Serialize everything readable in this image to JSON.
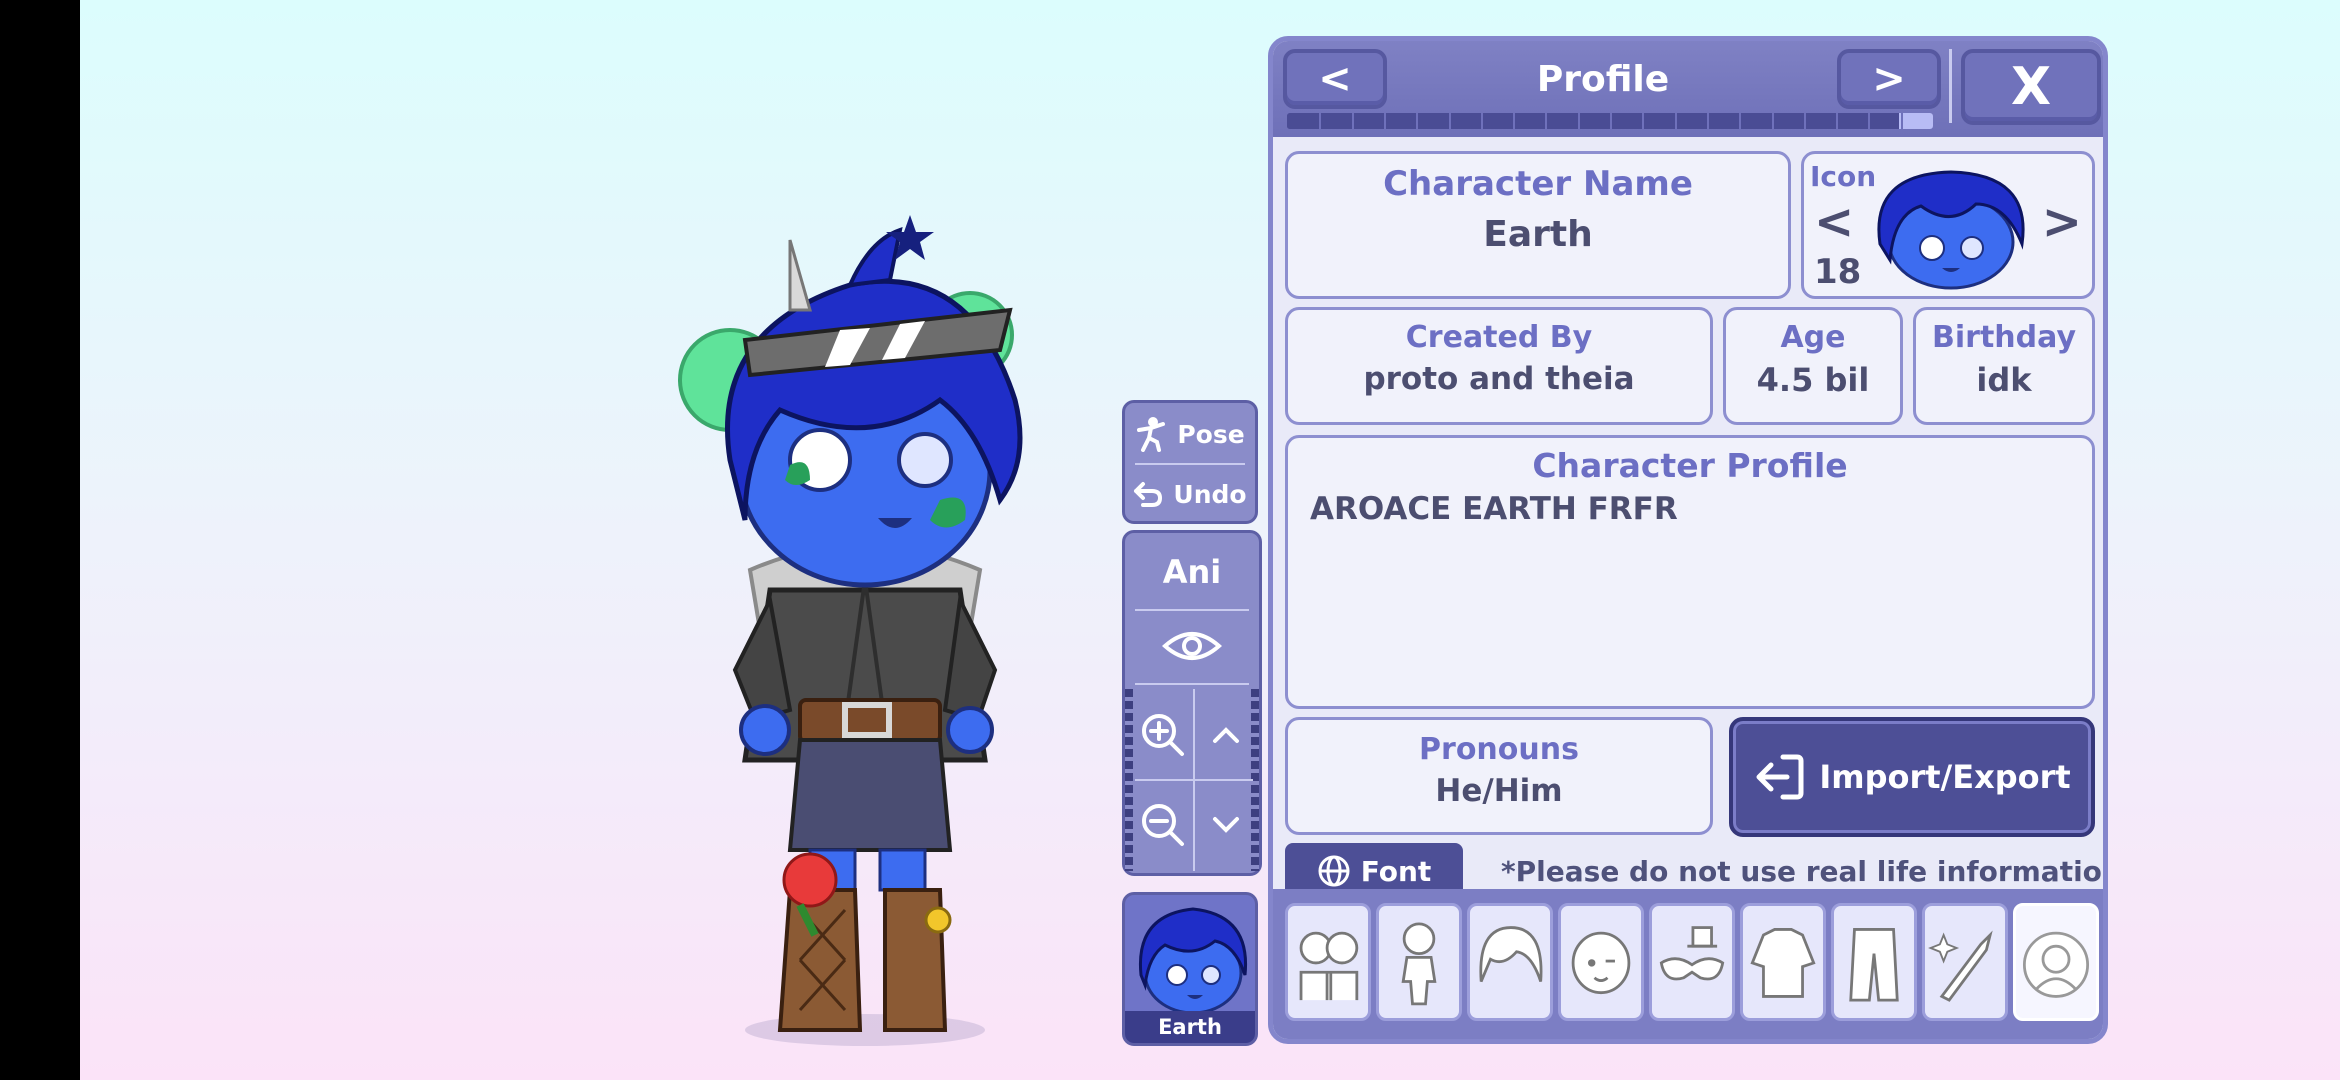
{
  "header": {
    "title": "Profile",
    "prev_label": "<",
    "next_label": ">",
    "close_label": "X",
    "progress_fraction": 0.95
  },
  "side": {
    "pose_label": "Pose",
    "undo_label": "Undo",
    "ani_label": "Ani",
    "slot_name": "Earth"
  },
  "profile": {
    "name_label": "Character Name",
    "name_value": "Earth",
    "icon_label": "Icon",
    "icon_number": "18",
    "icon_prev": "<",
    "icon_next": ">",
    "created_by_label": "Created By",
    "created_by_value": "proto and theia",
    "age_label": "Age",
    "age_value": "4.5 bil",
    "birthday_label": "Birthday",
    "birthday_value": "idk",
    "character_profile_label": "Character Profile",
    "character_profile_value": "AROACE EARTH FRFR",
    "pronouns_label": "Pronouns",
    "pronouns_value": "He/Him",
    "import_export_label": "Import/Export",
    "font_label": "Font",
    "notice": "*Please do not use real life information!"
  },
  "tabs": [
    {
      "icon": "characters-icon"
    },
    {
      "icon": "body-icon"
    },
    {
      "icon": "hair-icon"
    },
    {
      "icon": "face-icon"
    },
    {
      "icon": "accessory-icon"
    },
    {
      "icon": "shirt-icon"
    },
    {
      "icon": "pants-icon"
    },
    {
      "icon": "weapon-icon"
    },
    {
      "icon": "profile-icon",
      "active": true
    }
  ],
  "colors": {
    "accent": "#7072bb",
    "field_label": "#6c6fc4",
    "import_button": "#4d4f96",
    "skin": "#3d6cf0",
    "hair": "#1f2ec8"
  }
}
